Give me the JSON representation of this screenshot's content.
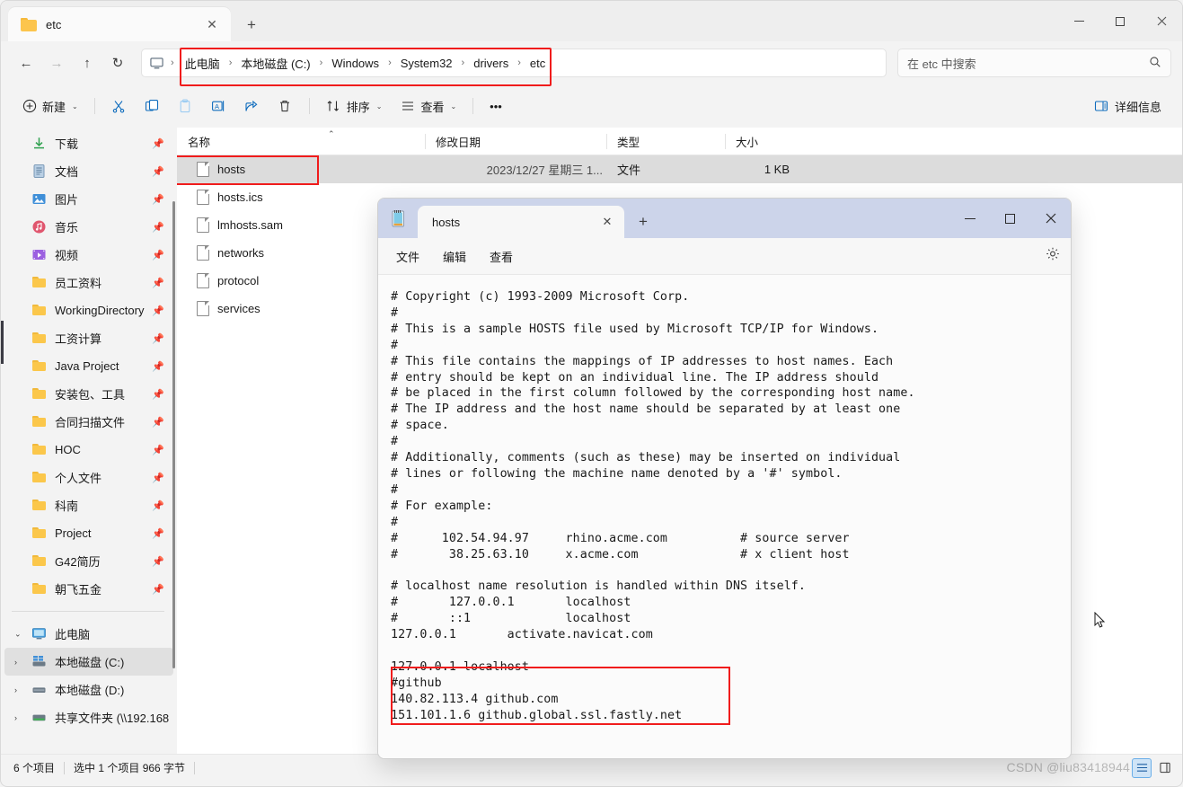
{
  "explorer": {
    "tab": {
      "title": "etc",
      "close_label": "✕",
      "new_tab_label": "+"
    },
    "window_controls": {
      "minimize": "—",
      "maximize": "☐",
      "close": "✕"
    },
    "nav": {
      "back": "←",
      "forward": "→",
      "up": "↑",
      "refresh": "↻"
    },
    "breadcrumb": {
      "root_icon": "this-pc-icon",
      "separator": "›",
      "items": [
        "此电脑",
        "本地磁盘 (C:)",
        "Windows",
        "System32",
        "drivers",
        "etc"
      ]
    },
    "search": {
      "placeholder": "在 etc 中搜索",
      "icon": "search-icon"
    },
    "commandbar": {
      "new_label": "新建",
      "cut_label": "剪切",
      "copy_label": "复制",
      "paste_label": "粘贴",
      "rename_label": "重命名",
      "share_label": "共享",
      "delete_label": "删除",
      "sort_label": "排序",
      "view_label": "查看",
      "more_label": "•••",
      "details_label": "详细信息",
      "chevron": "⌄"
    },
    "sidebar": {
      "items": [
        {
          "label": "下载",
          "icon": "download-icon",
          "pinned": true
        },
        {
          "label": "文档",
          "icon": "documents-icon",
          "pinned": true
        },
        {
          "label": "图片",
          "icon": "pictures-icon",
          "pinned": true
        },
        {
          "label": "音乐",
          "icon": "music-icon",
          "pinned": true
        },
        {
          "label": "视频",
          "icon": "videos-icon",
          "pinned": true
        },
        {
          "label": "员工资料",
          "icon": "folder-icon",
          "pinned": true
        },
        {
          "label": "WorkingDirectory",
          "icon": "folder-icon",
          "pinned": true
        },
        {
          "label": "工资计算",
          "icon": "folder-icon",
          "pinned": true
        },
        {
          "label": "Java Project",
          "icon": "folder-icon",
          "pinned": true
        },
        {
          "label": "安装包、工具",
          "icon": "folder-icon",
          "pinned": true
        },
        {
          "label": "合同扫描文件",
          "icon": "folder-icon",
          "pinned": true
        },
        {
          "label": "HOC",
          "icon": "folder-icon",
          "pinned": true
        },
        {
          "label": "个人文件",
          "icon": "folder-icon",
          "pinned": true
        },
        {
          "label": "科南",
          "icon": "folder-icon",
          "pinned": true
        },
        {
          "label": "Project",
          "icon": "folder-icon",
          "pinned": true
        },
        {
          "label": "G42简历",
          "icon": "folder-icon",
          "pinned": true
        },
        {
          "label": "朝飞五金",
          "icon": "folder-icon",
          "pinned": true
        }
      ],
      "tree": [
        {
          "label": "此电脑",
          "icon": "this-pc-icon",
          "expanded": true,
          "chevron": "⌄",
          "selected": false
        },
        {
          "label": "本地磁盘 (C:)",
          "icon": "drive-c-icon",
          "expanded": false,
          "chevron": "›",
          "selected": true
        },
        {
          "label": "本地磁盘 (D:)",
          "icon": "drive-icon",
          "expanded": false,
          "chevron": "›",
          "selected": false
        },
        {
          "label": "共享文件夹 (\\\\192.168",
          "icon": "network-drive-icon",
          "expanded": false,
          "chevron": "›",
          "selected": false
        }
      ]
    },
    "filelist": {
      "columns": [
        "名称",
        "修改日期",
        "类型",
        "大小"
      ],
      "sort_indicator": "⌃",
      "rows": [
        {
          "name": "hosts",
          "date": "2023/12/27 星期三 1...",
          "type": "文件",
          "size": "1 KB",
          "selected": true,
          "highlighted": true
        },
        {
          "name": "hosts.ics",
          "date": "",
          "type": "",
          "size": "",
          "selected": false,
          "highlighted": false
        },
        {
          "name": "lmhosts.sam",
          "date": "",
          "type": "",
          "size": "",
          "selected": false,
          "highlighted": false
        },
        {
          "name": "networks",
          "date": "",
          "type": "",
          "size": "",
          "selected": false,
          "highlighted": false
        },
        {
          "name": "protocol",
          "date": "",
          "type": "",
          "size": "",
          "selected": false,
          "highlighted": false
        },
        {
          "name": "services",
          "date": "",
          "type": "",
          "size": "",
          "selected": false,
          "highlighted": false
        }
      ]
    },
    "statusbar": {
      "item_count": "6 个项目",
      "selection": "选中 1 个项目  966 字节",
      "watermark": "CSDN @liu83418944",
      "layout_list_icon": "list-view-icon",
      "layout_details_icon": "details-view-icon"
    }
  },
  "notepad": {
    "app_icon": "notepad-icon",
    "tab": {
      "title": "hosts",
      "close_label": "✕"
    },
    "new_tab_label": "+",
    "window_controls": {
      "minimize": "—",
      "maximize": "☐",
      "close": "✕"
    },
    "menu": [
      "文件",
      "编辑",
      "查看"
    ],
    "settings_icon": "gear-icon",
    "content": "# Copyright (c) 1993-2009 Microsoft Corp.\n#\n# This is a sample HOSTS file used by Microsoft TCP/IP for Windows.\n#\n# This file contains the mappings of IP addresses to host names. Each\n# entry should be kept on an individual line. The IP address should\n# be placed in the first column followed by the corresponding host name.\n# The IP address and the host name should be separated by at least one\n# space.\n#\n# Additionally, comments (such as these) may be inserted on individual\n# lines or following the machine name denoted by a '#' symbol.\n#\n# For example:\n#\n#      102.54.94.97     rhino.acme.com          # source server\n#       38.25.63.10     x.acme.com              # x client host\n\n# localhost name resolution is handled within DNS itself.\n#       127.0.0.1       localhost\n#       ::1             localhost\n127.0.0.1       activate.navicat.com\n\n127.0.0.1 localhost\n#github\n140.82.113.4 github.com\n151.101.1.6 github.global.ssl.fastly.net"
  },
  "colors": {
    "highlight_red": "#f01c1c",
    "notepad_titlebar": "#ccd4ea",
    "selection_gray": "#dcdcdc",
    "accent_blue": "#0f6cbd"
  }
}
